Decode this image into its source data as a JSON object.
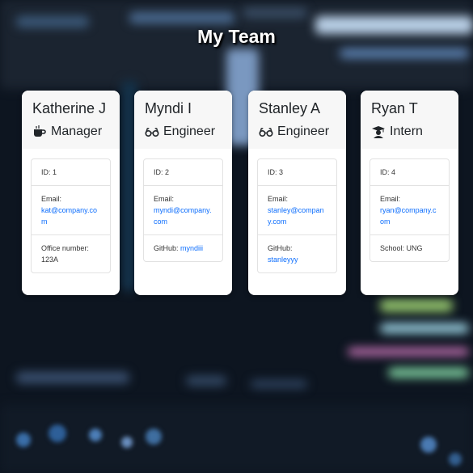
{
  "page": {
    "title": "My Team"
  },
  "colors": {
    "link": "#0d6efd",
    "header_bg": "#f7f7f7",
    "card_bg": "#ffffff"
  },
  "members": [
    {
      "name": "Katherine J",
      "role": "Manager",
      "role_icon": "coffee-icon",
      "id_text": "ID: 1",
      "email_label": "Email:",
      "email": "kat@company.com",
      "extra_label": "Office number:",
      "extra_value": "123A"
    },
    {
      "name": "Myndi I",
      "role": "Engineer",
      "role_icon": "glasses-icon",
      "id_text": "ID: 2",
      "email_label": "Email:",
      "email": "myndi@company.com",
      "extra_label": "GitHub:",
      "extra_value": "myndiii"
    },
    {
      "name": "Stanley A",
      "role": "Engineer",
      "role_icon": "glasses-icon",
      "id_text": "ID: 3",
      "email_label": "Email:",
      "email": "stanley@company.com",
      "extra_label": "GitHub:",
      "extra_value": "stanleyyy"
    },
    {
      "name": "Ryan T",
      "role": "Intern",
      "role_icon": "graduate-icon",
      "id_text": "ID: 4",
      "email_label": "Email:",
      "email": "ryan@company.com",
      "extra_label": "School:",
      "extra_value": "UNG"
    }
  ]
}
